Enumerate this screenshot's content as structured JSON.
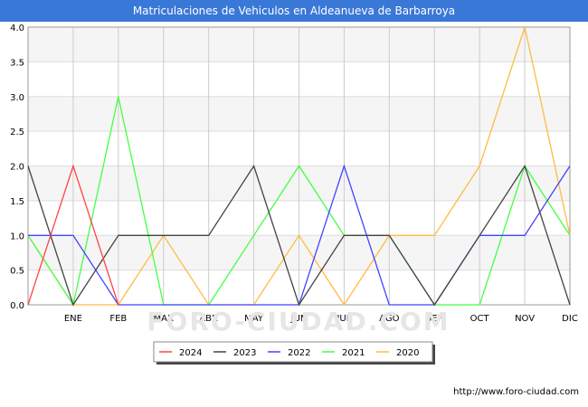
{
  "chart_data": {
    "type": "line",
    "title": "Matriculaciones de Vehiculos en Aldeanueva de Barbarroya",
    "x": [
      "",
      "ENE",
      "FEB",
      "MAR",
      "ABR",
      "MAY",
      "JUN",
      "JUL",
      "AGO",
      "SEP",
      "OCT",
      "NOV",
      "DIC"
    ],
    "ylim": [
      0,
      4
    ],
    "yticks": [
      "0.0",
      "0.5",
      "1.0",
      "1.5",
      "2.0",
      "2.5",
      "3.0",
      "3.5",
      "4.0"
    ],
    "grid": true,
    "legend_position": "bottom",
    "series": [
      {
        "name": "2024",
        "color": "#ff4444",
        "values": [
          0,
          2,
          0,
          null,
          null,
          null,
          null,
          null,
          null,
          null,
          null,
          null,
          null
        ]
      },
      {
        "name": "2023",
        "color": "#444444",
        "values": [
          2,
          0,
          1,
          1,
          1,
          2,
          0,
          1,
          1,
          0,
          1,
          2,
          0
        ]
      },
      {
        "name": "2022",
        "color": "#4444ff",
        "values": [
          1,
          1,
          0,
          0,
          0,
          0,
          0,
          2,
          0,
          0,
          1,
          1,
          2
        ]
      },
      {
        "name": "2021",
        "color": "#44ff44",
        "values": [
          1,
          0,
          3,
          0,
          0,
          1,
          2,
          1,
          1,
          0,
          0,
          2,
          1
        ]
      },
      {
        "name": "2020",
        "color": "#ffbb44",
        "values": [
          1,
          0,
          0,
          1,
          0,
          0,
          1,
          0,
          1,
          1,
          2,
          4,
          1
        ]
      }
    ]
  },
  "footer": {
    "url": "http://www.foro-ciudad.com"
  },
  "watermark": "FORO-CIUDAD.COM"
}
